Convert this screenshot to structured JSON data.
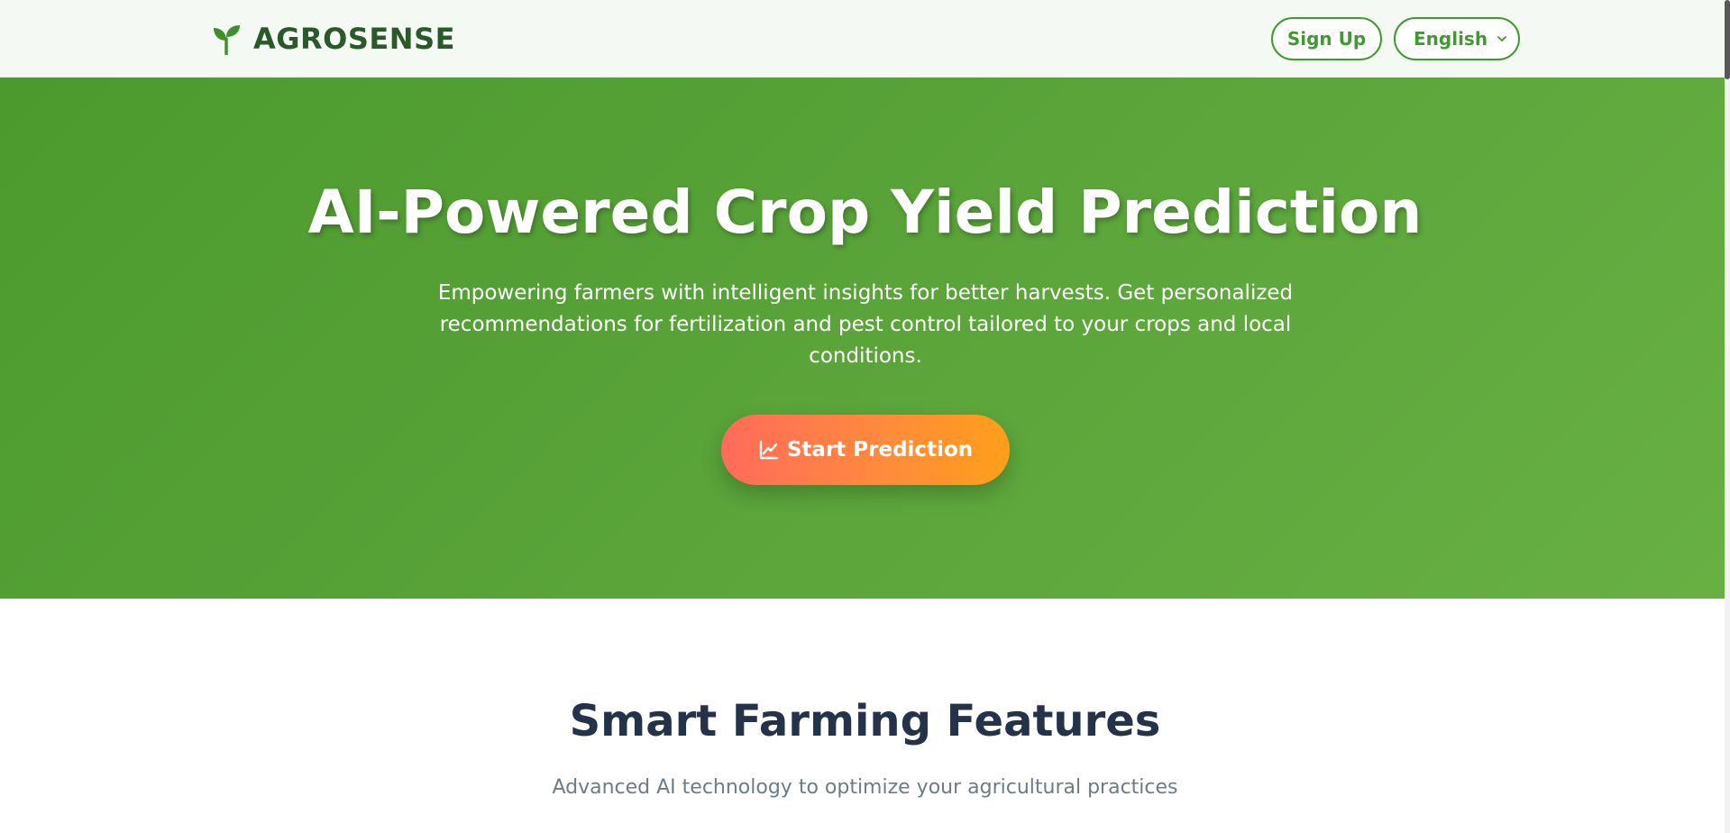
{
  "header": {
    "brand_name": "AGROSENSE",
    "brand_icon": "sprout-icon",
    "signup_label": "Sign Up",
    "language_selected": "English",
    "language_chevron_icon": "chevron-down-icon"
  },
  "hero": {
    "title": "AI-Powered Crop Yield Prediction",
    "subtitle": "Empowering farmers with intelligent insights for better harvests. Get personalized recommendations for fertilization and pest control tailored to your crops and local conditions.",
    "cta_label": "Start Prediction",
    "cta_icon": "chart-line-icon"
  },
  "features": {
    "title": "Smart Farming Features",
    "subtitle": "Advanced AI technology to optimize your agricultural practices"
  },
  "colors": {
    "brand_green": "#2a5a2a",
    "accent_green": "#3f9a2f",
    "hero_green": "#5aa43a",
    "cta_orange": "#ff9f1a",
    "cta_coral": "#ff6b5b",
    "heading_dark": "#243349",
    "muted_text": "#6b7c89"
  }
}
